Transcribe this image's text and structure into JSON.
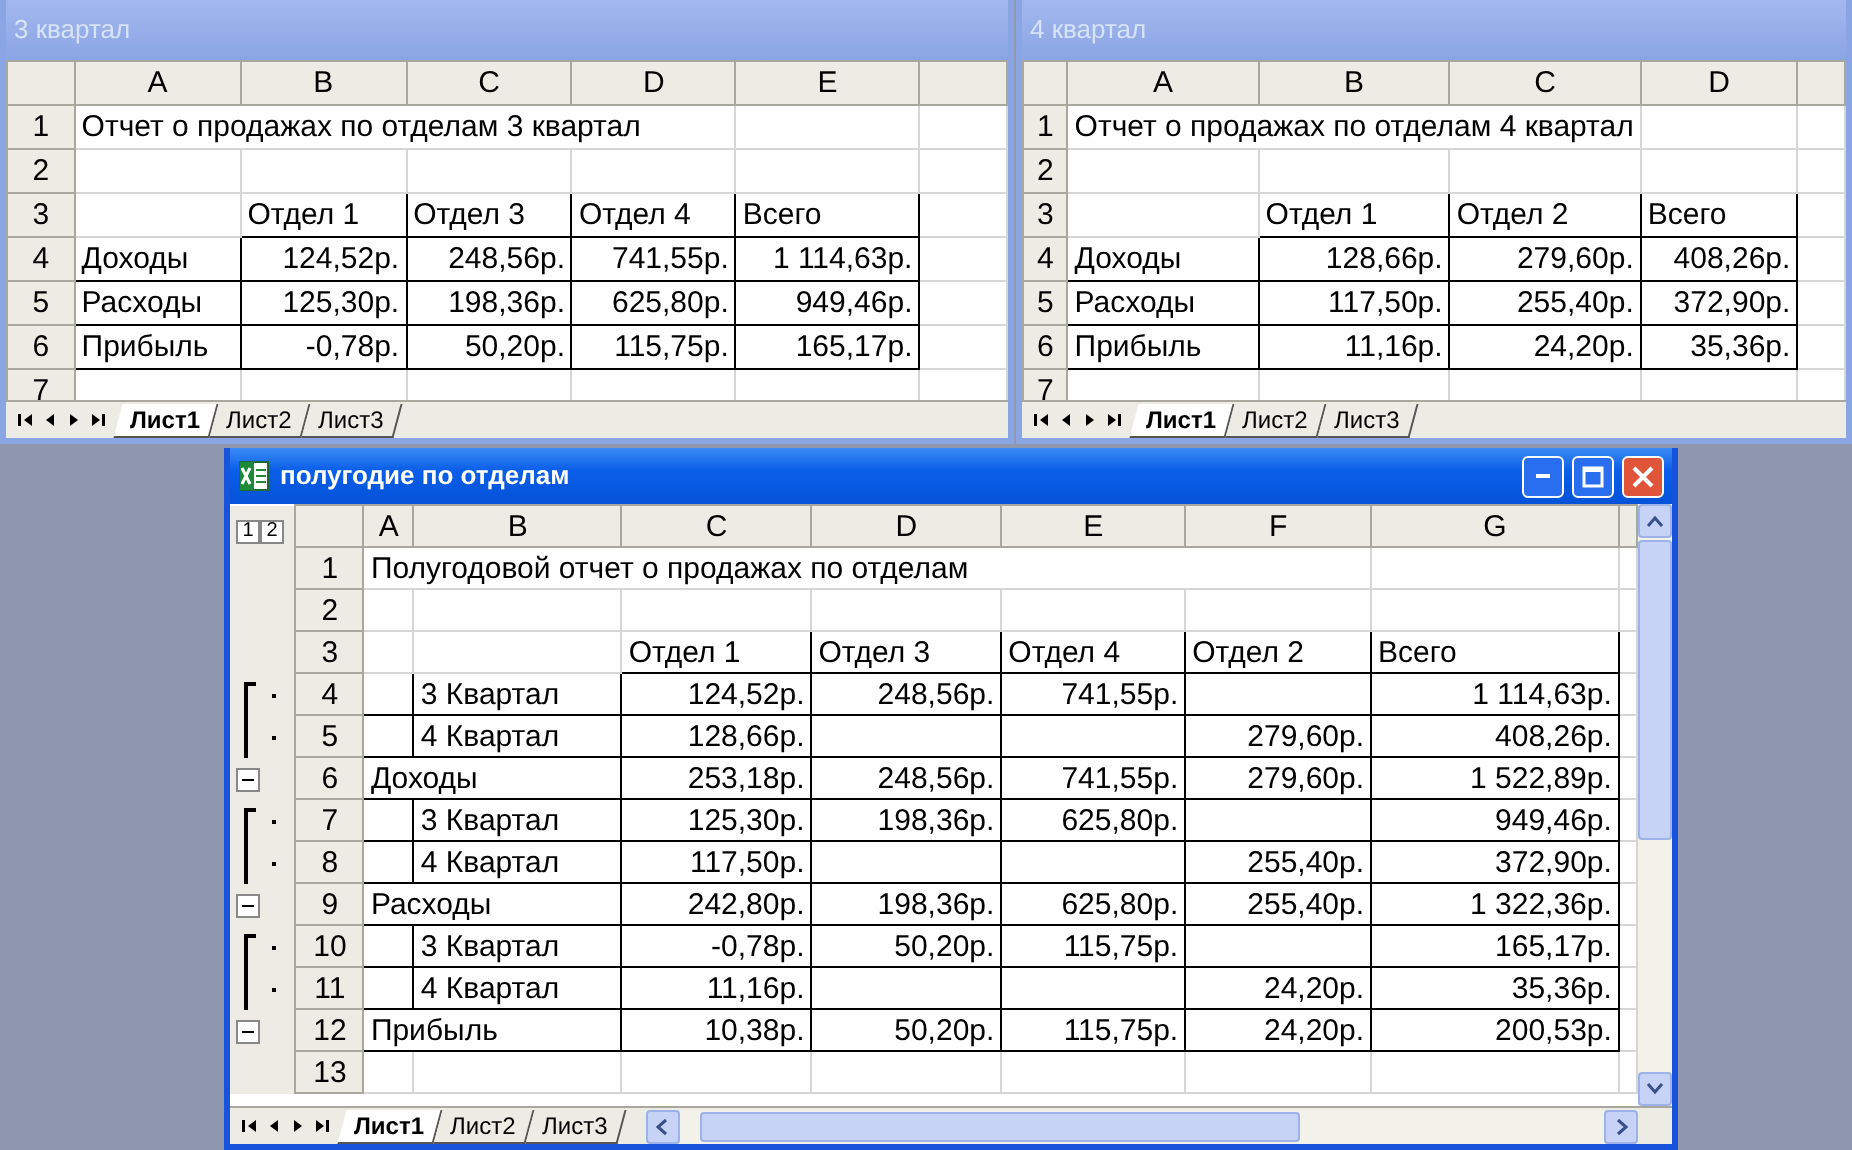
{
  "windows": [
    {
      "title": "3 квартал",
      "active": false,
      "columns": [
        "A",
        "B",
        "C",
        "D",
        "E"
      ],
      "rows": [
        {
          "number": "1",
          "kind": "title",
          "text": "Отчет о продажах по отделам 3 квартал"
        },
        {
          "number": "2",
          "kind": "blank"
        },
        {
          "number": "3",
          "kind": "header",
          "values": [
            "Отдел 1",
            "Отдел 3",
            "Отдел 4",
            "Всего"
          ]
        },
        {
          "number": "4",
          "kind": "total",
          "label": "Доходы",
          "values": [
            "124,52р.",
            "248,56р.",
            "741,55р.",
            "1 114,63р."
          ]
        },
        {
          "number": "5",
          "kind": "total",
          "label": "Расходы",
          "values": [
            "125,30р.",
            "198,36р.",
            "625,80р.",
            "949,46р."
          ]
        },
        {
          "number": "6",
          "kind": "total",
          "label": "Прибыль",
          "values": [
            "-0,78р.",
            "50,20р.",
            "115,75р.",
            "165,17р."
          ]
        },
        {
          "number": "7",
          "kind": "blank"
        }
      ],
      "sheets": [
        {
          "label": "Лист1",
          "selected": true
        },
        {
          "label": "Лист2",
          "selected": false
        },
        {
          "label": "Лист3",
          "selected": false
        }
      ]
    },
    {
      "title": "4 квартал",
      "active": false,
      "columns": [
        "A",
        "B",
        "C",
        "D"
      ],
      "rows": [
        {
          "number": "1",
          "kind": "title",
          "text": "Отчет о продажах по отделам 4 квартал"
        },
        {
          "number": "2",
          "kind": "blank"
        },
        {
          "number": "3",
          "kind": "header",
          "values": [
            "Отдел 1",
            "Отдел 2",
            "Всего"
          ]
        },
        {
          "number": "4",
          "kind": "total",
          "label": "Доходы",
          "values": [
            "128,66р.",
            "279,60р.",
            "408,26р."
          ]
        },
        {
          "number": "5",
          "kind": "total",
          "label": "Расходы",
          "values": [
            "117,50р.",
            "255,40р.",
            "372,90р."
          ]
        },
        {
          "number": "6",
          "kind": "total",
          "label": "Прибыль",
          "values": [
            "11,16р.",
            "24,20р.",
            "35,36р."
          ]
        },
        {
          "number": "7",
          "kind": "blank"
        }
      ],
      "sheets": [
        {
          "label": "Лист1",
          "selected": true
        },
        {
          "label": "Лист2",
          "selected": false
        },
        {
          "label": "Лист3",
          "selected": false
        }
      ]
    },
    {
      "title": "полугодие по отделам",
      "active": true,
      "outline_levels": [
        "1",
        "2"
      ],
      "columns": [
        "A",
        "B",
        "C",
        "D",
        "E",
        "F",
        "G"
      ],
      "rows": [
        {
          "number": "1",
          "kind": "title",
          "text": "Полугодовой отчет о продажах по отделам"
        },
        {
          "number": "2",
          "kind": "blank"
        },
        {
          "number": "3",
          "kind": "header",
          "values": [
            "Отдел 1",
            "Отдел 3",
            "Отдел 4",
            "Отдел 2",
            "Всего"
          ]
        },
        {
          "number": "4",
          "kind": "detail",
          "label": "3 Квартал",
          "values": [
            {
              "kind": "value",
              "text": "124,52р."
            },
            {
              "kind": "value",
              "text": "248,56р."
            },
            {
              "kind": "value",
              "text": "741,55р."
            },
            {
              "kind": "empty"
            },
            {
              "kind": "value",
              "text": "1 114,63р."
            }
          ]
        },
        {
          "number": "5",
          "kind": "detail",
          "label": "4 Квартал",
          "values": [
            {
              "kind": "value",
              "text": "128,66р."
            },
            {
              "kind": "empty"
            },
            {
              "kind": "empty"
            },
            {
              "kind": "value",
              "text": "279,60р."
            },
            {
              "kind": "value",
              "text": "408,26р."
            }
          ]
        },
        {
          "number": "6",
          "kind": "total",
          "expanded": true,
          "label": "Доходы",
          "values": [
            "253,18р.",
            "248,56р.",
            "741,55р.",
            "279,60р.",
            "1 522,89р."
          ]
        },
        {
          "number": "7",
          "kind": "detail",
          "label": "3 Квартал",
          "values": [
            {
              "kind": "value",
              "text": "125,30р."
            },
            {
              "kind": "value",
              "text": "198,36р."
            },
            {
              "kind": "value",
              "text": "625,80р."
            },
            {
              "kind": "empty"
            },
            {
              "kind": "value",
              "text": "949,46р."
            }
          ]
        },
        {
          "number": "8",
          "kind": "detail",
          "label": "4 Квартал",
          "values": [
            {
              "kind": "value",
              "text": "117,50р."
            },
            {
              "kind": "empty"
            },
            {
              "kind": "empty"
            },
            {
              "kind": "value",
              "text": "255,40р."
            },
            {
              "kind": "value",
              "text": "372,90р."
            }
          ]
        },
        {
          "number": "9",
          "kind": "total",
          "expanded": true,
          "label": "Расходы",
          "values": [
            "242,80р.",
            "198,36р.",
            "625,80р.",
            "255,40р.",
            "1 322,36р."
          ]
        },
        {
          "number": "10",
          "kind": "detail",
          "label": "3 Квартал",
          "values": [
            {
              "kind": "value",
              "text": "-0,78р."
            },
            {
              "kind": "value",
              "text": "50,20р."
            },
            {
              "kind": "value",
              "text": "115,75р."
            },
            {
              "kind": "empty"
            },
            {
              "kind": "value",
              "text": "165,17р."
            }
          ]
        },
        {
          "number": "11",
          "kind": "detail",
          "label": "4 Квартал",
          "values": [
            {
              "kind": "value",
              "text": "11,16р."
            },
            {
              "kind": "empty"
            },
            {
              "kind": "empty"
            },
            {
              "kind": "value",
              "text": "24,20р."
            },
            {
              "kind": "value",
              "text": "35,36р."
            }
          ]
        },
        {
          "number": "12",
          "kind": "total",
          "expanded": true,
          "label": "Прибыль",
          "values": [
            "10,38р.",
            "50,20р.",
            "115,75р.",
            "24,20р.",
            "200,53р."
          ]
        },
        {
          "number": "13",
          "kind": "blank"
        }
      ],
      "sheets": [
        {
          "label": "Лист1",
          "selected": true
        },
        {
          "label": "Лист2",
          "selected": false
        },
        {
          "label": "Лист3",
          "selected": false
        }
      ]
    }
  ]
}
